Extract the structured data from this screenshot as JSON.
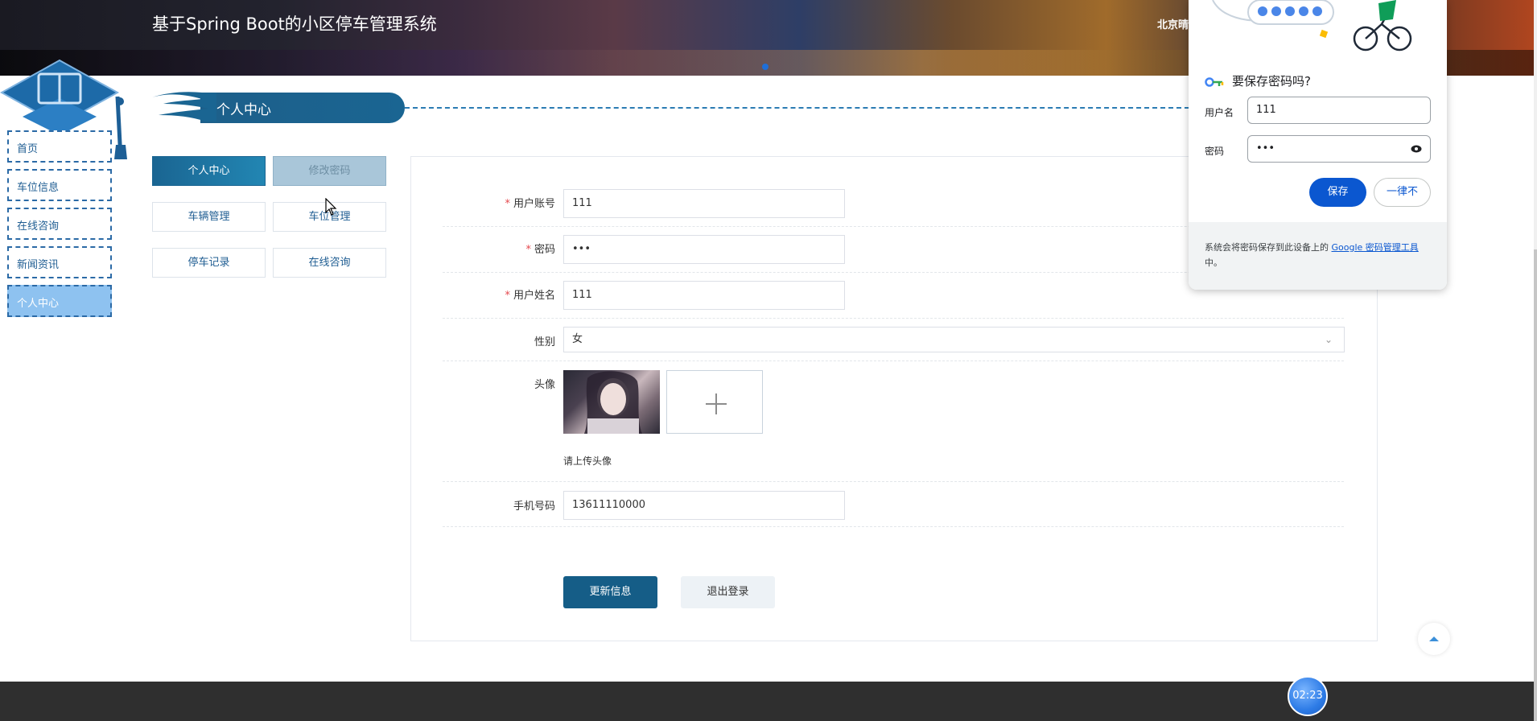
{
  "header": {
    "title": "基于Spring Boot的小区停车管理系统",
    "weather": "北京晴"
  },
  "nav": {
    "items": [
      {
        "label": "首页"
      },
      {
        "label": "车位信息"
      },
      {
        "label": "在线咨询"
      },
      {
        "label": "新闻资讯"
      },
      {
        "label": "个人中心",
        "active": true
      }
    ]
  },
  "section": {
    "title": "个人中心"
  },
  "submenu": {
    "personal_center": "个人中心",
    "change_password": "修改密码",
    "vehicle_mgmt": "车辆管理",
    "space_mgmt": "车位管理",
    "parking_records": "停车记录",
    "online_consult": "在线咨询"
  },
  "form": {
    "account_label": "用户账号",
    "account_value": "111",
    "password_label": "密码",
    "password_value": "•••",
    "name_label": "用户姓名",
    "name_value": "111",
    "gender_label": "性别",
    "gender_value": "女",
    "avatar_label": "头像",
    "avatar_hint": "请上传头像",
    "phone_label": "手机号码",
    "phone_value": "13611110000",
    "required_mark": "*"
  },
  "actions": {
    "update": "更新信息",
    "logout": "退出登录"
  },
  "timer": "02:23",
  "password_popup": {
    "title": "要保存密码吗?",
    "username_label": "用户名",
    "username_value": "111",
    "password_label": "密码",
    "password_value": "•••",
    "save": "保存",
    "never": "一律不",
    "footer_text": "系统会将密码保存到此设备上的 ",
    "footer_link": "Google 密码管理工具",
    "footer_suffix": "中。"
  },
  "colors": {
    "primary": "#155d87",
    "nav_border": "#2b6aa6",
    "nav_active": "#8ec2f0",
    "required": "#e5484d",
    "google_blue": "#0b57d0"
  }
}
